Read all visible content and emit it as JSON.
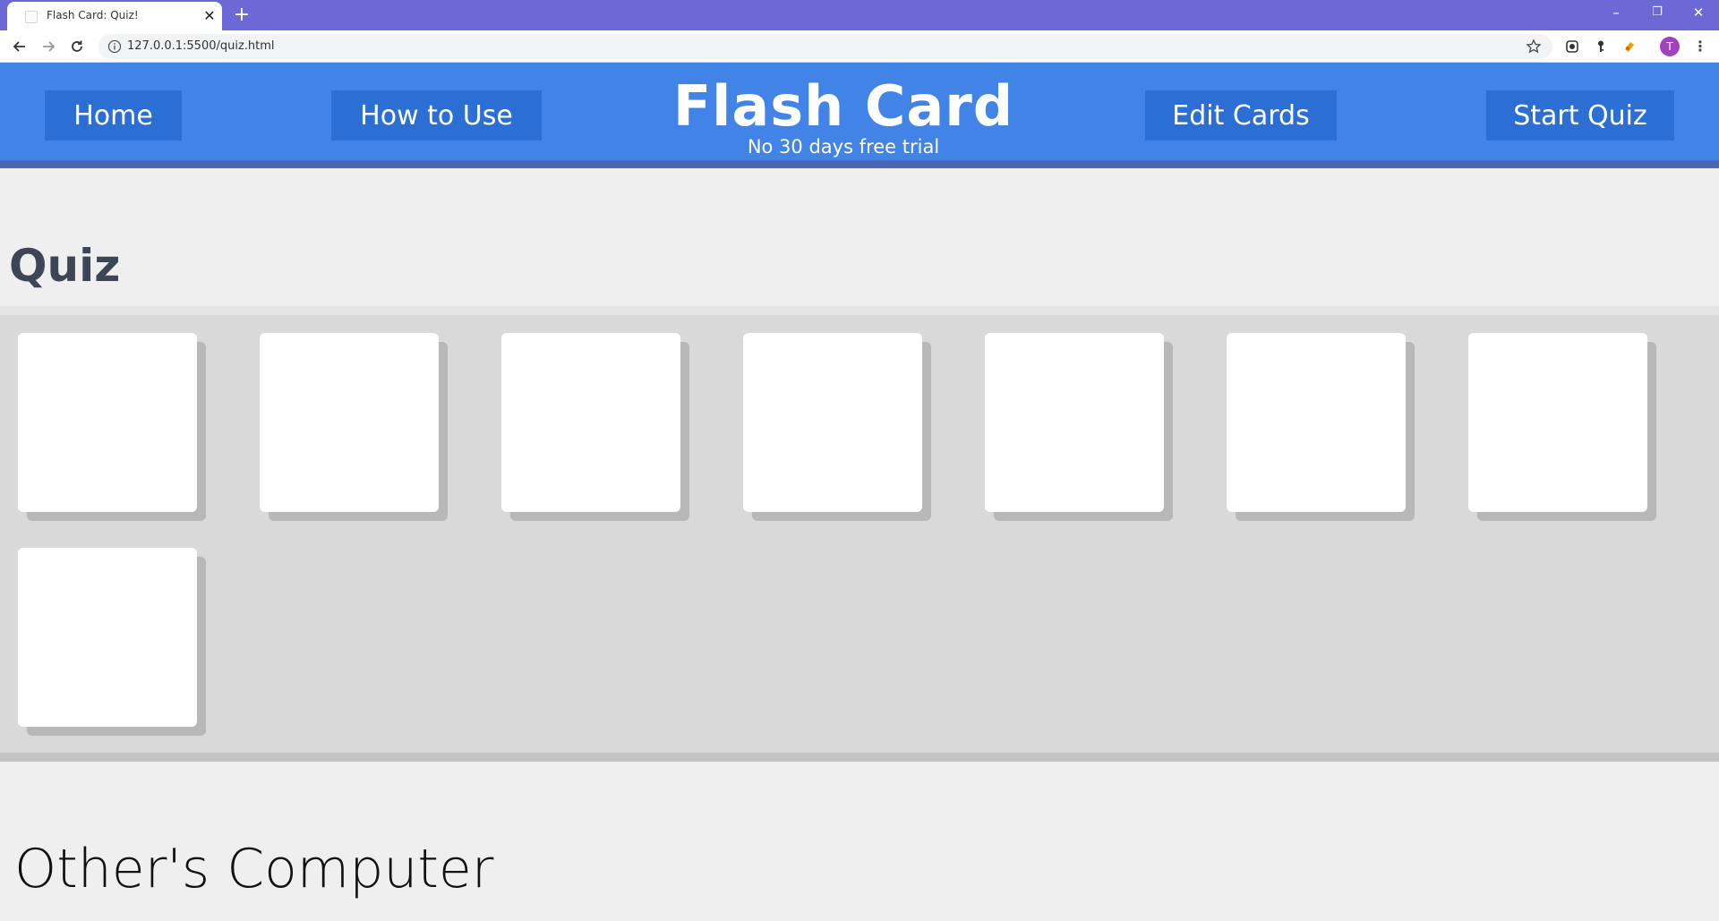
{
  "browser": {
    "tab_title": "Flash Card: Quiz!",
    "tab_close_glyph": "✕",
    "new_tab_glyph": "+",
    "url": "127.0.0.1:5500/quiz.html",
    "profile_initial": "T",
    "window_controls": {
      "minimize": "–",
      "restore": "❐",
      "close": "✕"
    },
    "menu_glyph": "⋮"
  },
  "header": {
    "nav": {
      "home": "Home",
      "how_to_use": "How to Use",
      "edit_cards": "Edit Cards",
      "start_quiz": "Start Quiz"
    },
    "brand_title": "Flash Card",
    "brand_subtitle": "No 30 days free trial",
    "colors": {
      "header_bg": "#4183e6",
      "button_bg": "#2b6fd4",
      "header_border": "#4b66b6"
    }
  },
  "main": {
    "heading": "Quiz",
    "cards_count": 8,
    "section_heading": "Other's Computer"
  }
}
